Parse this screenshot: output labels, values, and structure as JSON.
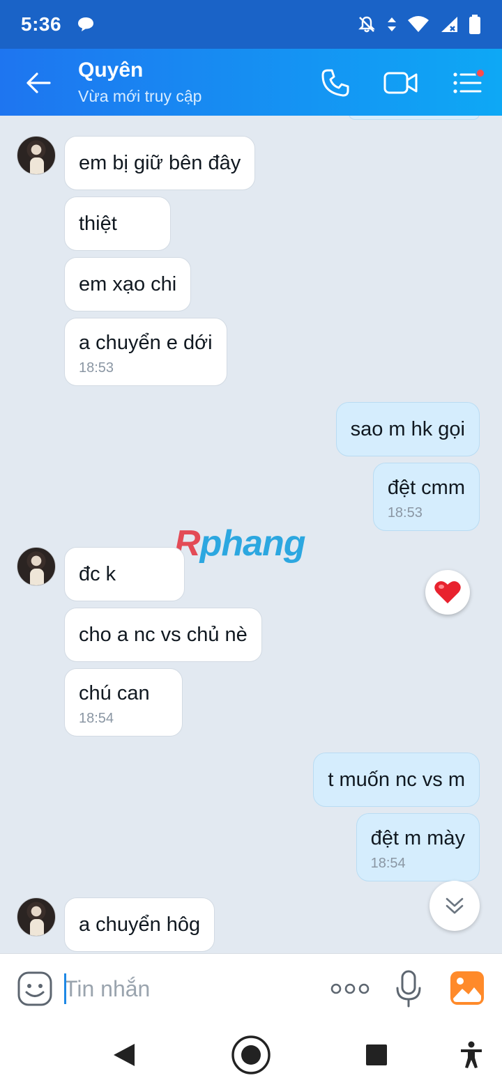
{
  "status_bar": {
    "time": "5:36"
  },
  "header": {
    "contact_name": "Quyên",
    "contact_status": "Vừa mới truy cập"
  },
  "messages": [
    {
      "from": "them",
      "text": "em bị giữ bên đây"
    },
    {
      "from": "them",
      "text": "thiệt"
    },
    {
      "from": "them",
      "text": "em xạo chi"
    },
    {
      "from": "them",
      "text": "a chuyển e dới",
      "time": "18:53"
    },
    {
      "from": "me",
      "text": "sao m hk gọi"
    },
    {
      "from": "me",
      "text": "đệt cmm",
      "time": "18:53"
    },
    {
      "from": "them",
      "text": "đc k"
    },
    {
      "from": "them",
      "text": "cho a nc vs chủ nè"
    },
    {
      "from": "them",
      "text": "chú can",
      "time": "18:54"
    },
    {
      "from": "me",
      "text": "t muốn nc vs m"
    },
    {
      "from": "me",
      "text": "đệt m mày",
      "time": "18:54"
    },
    {
      "from": "them",
      "text": "a chuyển hôg"
    }
  ],
  "watermark": {
    "part1": "R",
    "part2": "phang"
  },
  "input": {
    "placeholder": "Tin nhắn",
    "value": ""
  },
  "colors": {
    "header_start": "#1e75f0",
    "header_end": "#0ea8f5",
    "my_bubble": "#d5edfd",
    "their_bubble": "#ffffff",
    "background": "#e2e9f1"
  }
}
